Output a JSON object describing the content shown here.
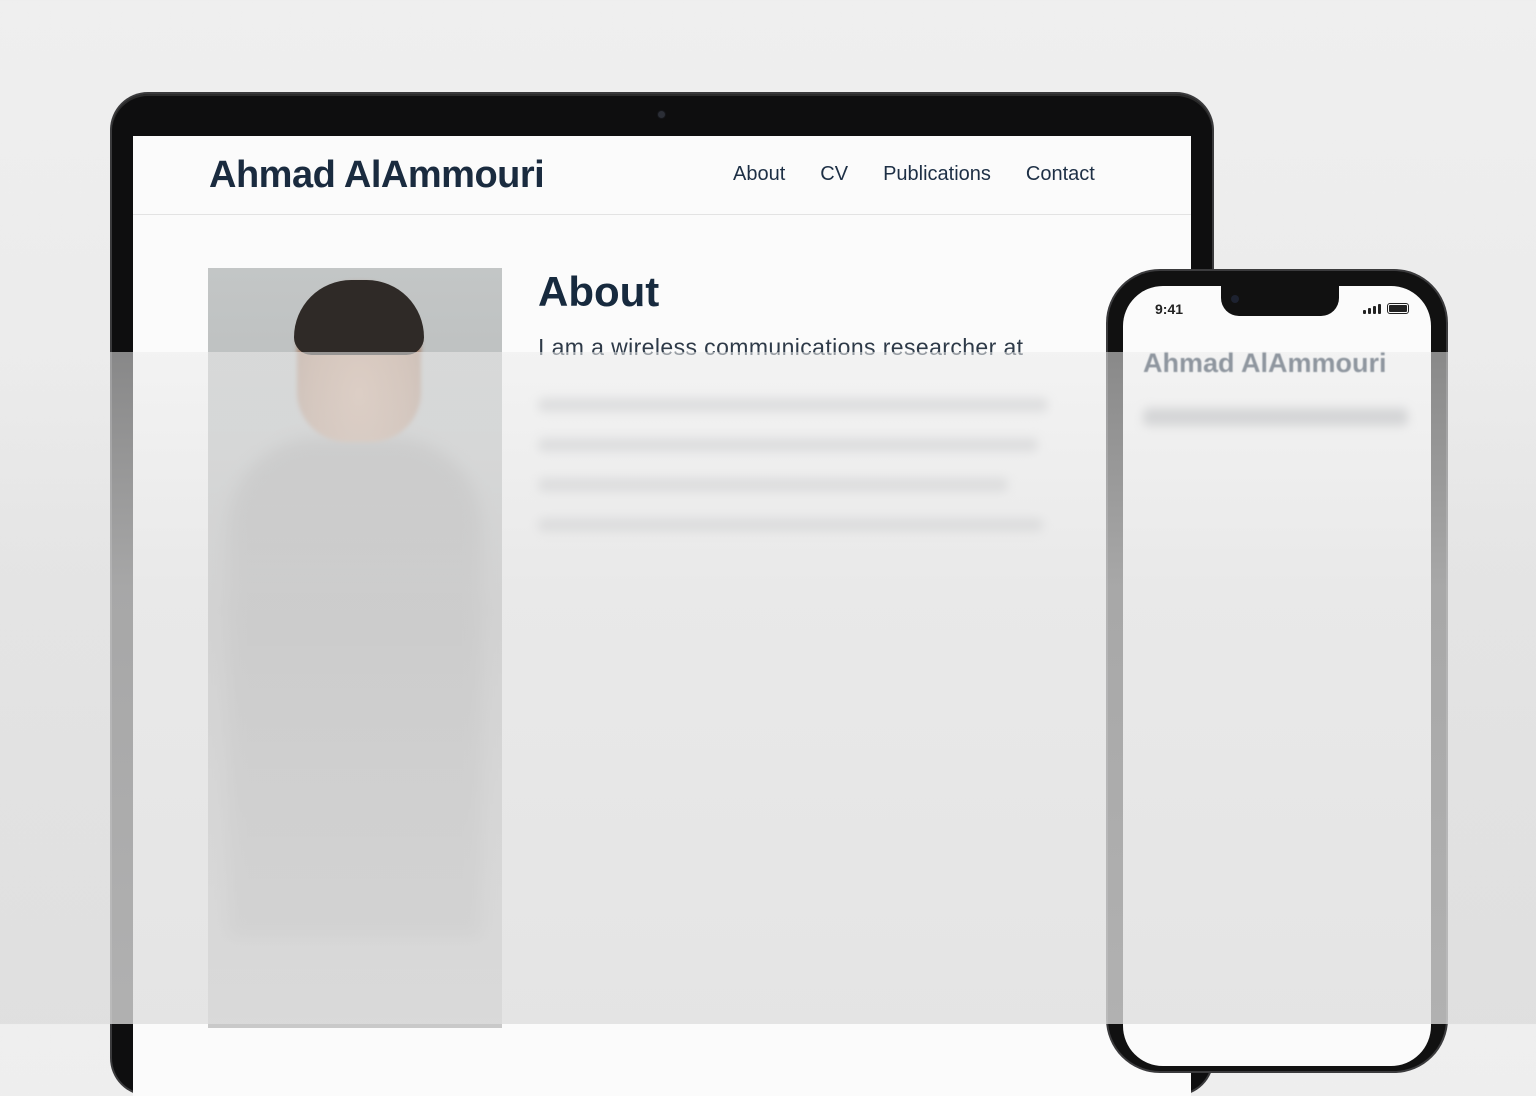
{
  "laptop": {
    "site_title": "Ahmad AlAmmouri",
    "nav": [
      "About",
      "CV",
      "Publications",
      "Contact"
    ],
    "section_heading": "About",
    "intro_text": "I am a wireless communications researcher at"
  },
  "phone": {
    "status_time": "9:41",
    "site_title": "Ahmad AlAmmouri"
  }
}
